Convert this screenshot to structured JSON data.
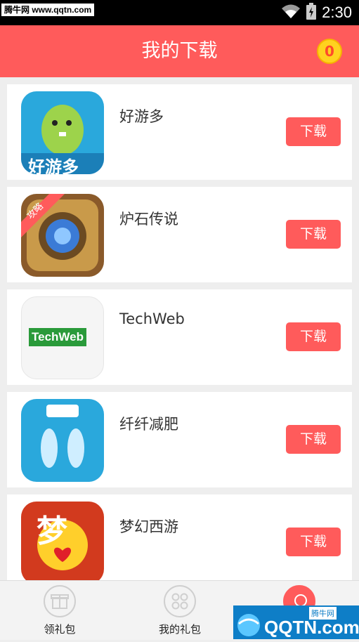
{
  "statusbar": {
    "watermark": "腾牛网 www.qqtn.com",
    "time": "2:30",
    "icons": [
      "wifi-icon",
      "battery-charging-icon"
    ]
  },
  "appbar": {
    "title": "我的下载",
    "coin_count": "0"
  },
  "apps": [
    {
      "name": "好游多",
      "icon_text": "好游多",
      "button": "下载"
    },
    {
      "name": "炉石传说",
      "icon_text": "攻略",
      "button": "下载"
    },
    {
      "name": "TechWeb",
      "icon_text": "TechWeb",
      "button": "下载"
    },
    {
      "name": "纤纤减肥",
      "icon_text": "",
      "button": "下载"
    },
    {
      "name": "梦幻西游",
      "icon_text": "梦",
      "button": "下载"
    }
  ],
  "bottom_nav": {
    "tabs": [
      {
        "label": "领礼包",
        "icon": "gift-icon"
      },
      {
        "label": "我的礼包",
        "icon": "grid-icon"
      },
      {
        "label": "",
        "icon": "ribbon-icon"
      }
    ]
  },
  "watermark_logo": {
    "site": "腾牛网",
    "text": "QQTN.com"
  },
  "colors": {
    "accent": "#ff5b5b",
    "coin": "#ffd21f",
    "background": "#eeeeee"
  }
}
